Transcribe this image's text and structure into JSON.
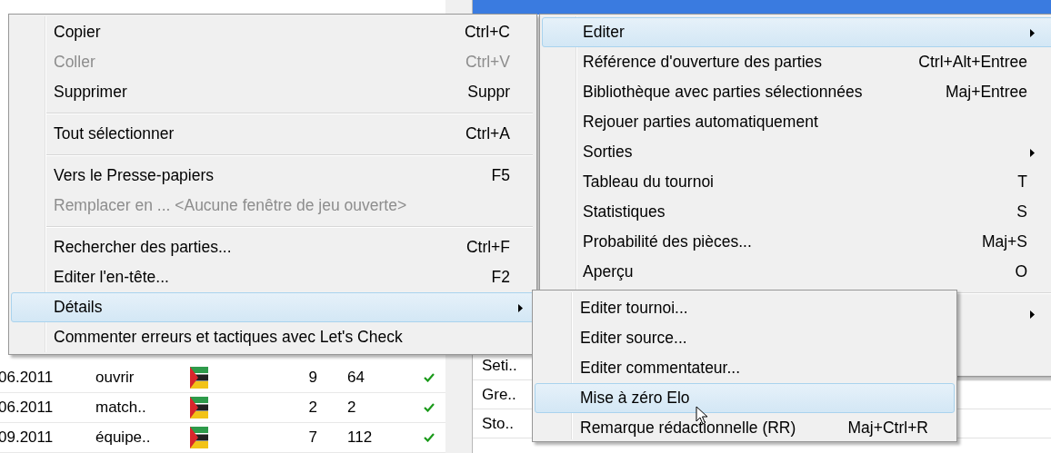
{
  "game_table": {
    "rows": [
      {
        "date": "06.2011",
        "event": "ouvrir",
        "rounds": "9",
        "games": "64",
        "checked": true
      },
      {
        "date": "06.2011",
        "event": "match..",
        "rounds": "2",
        "games": "2",
        "checked": true
      },
      {
        "date": "09.2011",
        "event": "équipe..",
        "rounds": "7",
        "games": "112",
        "checked": true
      }
    ]
  },
  "player_list": {
    "items": [
      "Seti..",
      "Gre..",
      "Sto.."
    ]
  },
  "context_menu": {
    "items": [
      {
        "kind": "item",
        "label": "Copier",
        "shortcut": "Ctrl+C",
        "disabled": false,
        "selected": false,
        "submenu": false
      },
      {
        "kind": "item",
        "label": "Coller",
        "shortcut": "Ctrl+V",
        "disabled": true,
        "selected": false,
        "submenu": false
      },
      {
        "kind": "item",
        "label": "Supprimer",
        "shortcut": "Suppr",
        "disabled": false,
        "selected": false,
        "submenu": false
      },
      {
        "kind": "separator"
      },
      {
        "kind": "item",
        "label": "Tout sélectionner",
        "shortcut": "Ctrl+A",
        "disabled": false,
        "selected": false,
        "submenu": false
      },
      {
        "kind": "separator"
      },
      {
        "kind": "item",
        "label": "Vers le Presse-papiers",
        "shortcut": "F5",
        "disabled": false,
        "selected": false,
        "submenu": false
      },
      {
        "kind": "item",
        "label": "Remplacer en ... <Aucune fenêtre de jeu ouverte>",
        "disabled": true,
        "selected": false,
        "submenu": false
      },
      {
        "kind": "separator"
      },
      {
        "kind": "item",
        "label": "Rechercher des parties...",
        "shortcut": "Ctrl+F",
        "disabled": false,
        "selected": false,
        "submenu": false
      },
      {
        "kind": "item",
        "label": "Editer l'en-tête...",
        "shortcut": "F2",
        "disabled": false,
        "selected": false,
        "submenu": false
      },
      {
        "kind": "item",
        "label": "Détails",
        "disabled": false,
        "selected": true,
        "submenu": true
      },
      {
        "kind": "item",
        "label": "Commenter erreurs et tactiques avec Let's Check",
        "disabled": false,
        "selected": false,
        "submenu": false
      }
    ]
  },
  "edit_menu": {
    "items": [
      {
        "kind": "item",
        "label": "Editer",
        "disabled": false,
        "selected": true,
        "submenu": true
      },
      {
        "kind": "item",
        "label": "Référence d'ouverture des parties",
        "shortcut": "Ctrl+Alt+Entree",
        "disabled": false,
        "selected": false,
        "submenu": false
      },
      {
        "kind": "item",
        "label": "Bibliothèque avec parties sélectionnées",
        "shortcut": "Maj+Entree",
        "disabled": false,
        "selected": false,
        "submenu": false
      },
      {
        "kind": "item",
        "label": "Rejouer parties automatiquement",
        "disabled": false,
        "selected": false,
        "submenu": false
      },
      {
        "kind": "item",
        "label": "Sorties",
        "disabled": false,
        "selected": false,
        "submenu": true
      },
      {
        "kind": "item",
        "label": "Tableau du tournoi",
        "shortcut": "T",
        "disabled": false,
        "selected": false,
        "submenu": false
      },
      {
        "kind": "item",
        "label": "Statistiques",
        "shortcut": "S",
        "disabled": false,
        "selected": false,
        "submenu": false
      },
      {
        "kind": "item",
        "label": "Probabilité des pièces...",
        "shortcut": "Maj+S",
        "disabled": false,
        "selected": false,
        "submenu": false
      },
      {
        "kind": "item",
        "label": "Aperçu",
        "shortcut": "O",
        "disabled": false,
        "selected": false,
        "submenu": false
      },
      {
        "kind": "separator"
      },
      {
        "kind": "covered",
        "submenu": true
      }
    ]
  },
  "details_menu": {
    "items": [
      {
        "kind": "item",
        "label": "Editer tournoi...",
        "disabled": false,
        "selected": false,
        "submenu": false
      },
      {
        "kind": "item",
        "label": "Editer source...",
        "disabled": false,
        "selected": false,
        "submenu": false
      },
      {
        "kind": "item",
        "label": "Editer commentateur...",
        "disabled": false,
        "selected": false,
        "submenu": false
      },
      {
        "kind": "item",
        "label": "Mise à zéro Elo",
        "disabled": false,
        "selected": true,
        "submenu": false
      },
      {
        "kind": "item",
        "label": "Remarque rédactionnelle (RR)",
        "shortcut": "Maj+Ctrl+R",
        "disabled": false,
        "selected": false,
        "submenu": false
      }
    ]
  }
}
